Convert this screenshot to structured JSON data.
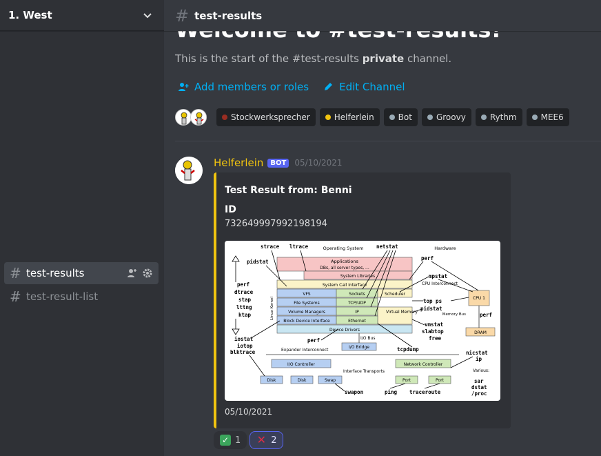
{
  "sidebar": {
    "server_name": "1. West",
    "channels": [
      {
        "label": "test-results",
        "active": true
      },
      {
        "label": "test-result-list",
        "active": false
      }
    ]
  },
  "header": {
    "channel_name": "test-results"
  },
  "welcome": {
    "title": "Welcome to #test-results!",
    "sub_prefix": "This is the start of the #test-results ",
    "sub_bold": "private",
    "sub_suffix": " channel.",
    "add_members_label": "Add members or roles",
    "edit_channel_label": "Edit Channel"
  },
  "roles": [
    {
      "name": "Stockwerksprecher",
      "color": "#992d22"
    },
    {
      "name": "Helferlein",
      "color": "#f1c40f"
    },
    {
      "name": "Bot",
      "color": "#99aab5"
    },
    {
      "name": "Groovy",
      "color": "#99aab5"
    },
    {
      "name": "Rythm",
      "color": "#99aab5"
    },
    {
      "name": "MEE6",
      "color": "#99aab5"
    }
  ],
  "message": {
    "author": "Helferlein",
    "author_color": "#f1c40f",
    "bot_tag": "BOT",
    "timestamp": "05/10/2021",
    "embed": {
      "title": "Test Result from: Benni",
      "field_name": "ID",
      "field_value": "732649997992198194",
      "footer": "05/10/2021",
      "accent_color": "#f1c40f"
    },
    "reactions": [
      {
        "emoji": "white-check-mark",
        "count": "1",
        "me": false
      },
      {
        "emoji": "cross-mark",
        "count": "2",
        "me": true
      }
    ]
  },
  "diagram": {
    "os_label": "Operating System",
    "hw_label": "Hardware",
    "kernel_label": "Linux Kernel",
    "layers": {
      "applications": "Applications",
      "applications_sub": "DBs, all server types, ...",
      "system_libraries": "System Libraries",
      "syscall": "System Call Interface",
      "vfs": "VFS",
      "sockets": "Sockets",
      "scheduler": "Scheduler",
      "file_systems": "File Systems",
      "tcp_udp": "TCP/UDP",
      "volume_managers": "Volume Managers",
      "ip": "IP",
      "virtual_memory": "Virtual Memory",
      "block_device": "Block Device Interface",
      "ethernet": "Ethernet",
      "device_drivers": "Device Drivers",
      "io_bus": "I/O Bus",
      "io_bridge": "I/O Bridge",
      "expander": "Expander Interconnect",
      "io_controller": "I/O Controller",
      "disk": "Disk",
      "swap": "Swap",
      "interface_transports": "Interface Transports",
      "network_controller": "Network Controller",
      "port": "Port",
      "cpu_interconnect": "CPU Interconnect",
      "cpu": "CPU 1",
      "memory_bus": "Memory Bus",
      "dram": "DRAM",
      "various": "Various:"
    },
    "tools": {
      "strace": "strace",
      "ltrace": "ltrace",
      "netstat": "netstat",
      "pidstat": "pidstat",
      "perf": "perf",
      "dtrace": "dtrace",
      "stap": "stap",
      "lttng": "lttng",
      "ktap": "ktap",
      "mpstat": "mpstat",
      "top_ps": "top ps",
      "vmstat": "vmstat",
      "slabtop": "slabtop",
      "free": "free",
      "iostat": "iostat",
      "iotop": "iotop",
      "blktrace": "blktrace",
      "tcpdump": "tcpdump",
      "nicstat": "nicstat",
      "ip": "ip",
      "sar": "sar",
      "dstat": "dstat",
      "proc": "/proc",
      "swapon": "swapon",
      "ping": "ping",
      "traceroute": "traceroute"
    }
  }
}
